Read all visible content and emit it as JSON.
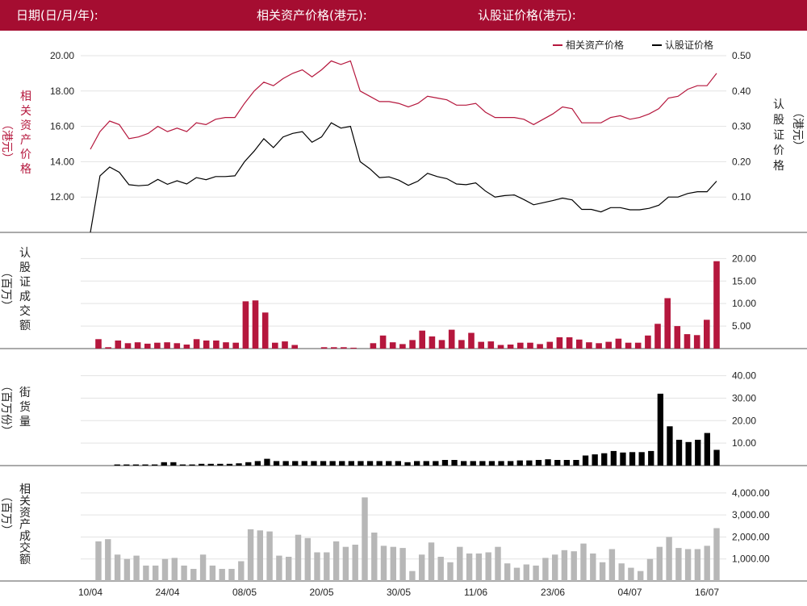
{
  "header": {
    "date_label": "日期(日/月/年):",
    "underlying_label": "相关资产价格(港元):",
    "warrant_label": "认股证价格(港元):"
  },
  "colors": {
    "brand": "#a50d31",
    "underlying": "#b5173d",
    "warrant": "#000000",
    "bar_red": "#b5173d",
    "bar_black": "#000000",
    "bar_gray": "#b7b7b7"
  },
  "chart_data": [
    {
      "type": "line",
      "panel": "price",
      "legend": [
        "相关资产价格",
        "认股证价格"
      ],
      "left_axis": {
        "label": [
          "相",
          "关",
          "资",
          "产",
          "价",
          "格"
        ],
        "unit": "（港元）",
        "ticks": [
          "12.00",
          "14.00",
          "16.00",
          "18.00",
          "20.00"
        ],
        "ylim": [
          10.0,
          20.5
        ]
      },
      "right_axis": {
        "label": [
          "认",
          "股",
          "证",
          "价",
          "格"
        ],
        "unit": "（港元）",
        "ticks": [
          "0.10",
          "0.20",
          "0.30",
          "0.40",
          "0.50"
        ],
        "ylim": [
          0.0,
          0.525
        ]
      },
      "x_ticks": [
        {
          "label": "10/04",
          "index": 0
        },
        {
          "label": "24/04",
          "index": 8
        },
        {
          "label": "08/05",
          "index": 16
        },
        {
          "label": "20/05",
          "index": 24
        },
        {
          "label": "30/05",
          "index": 32
        },
        {
          "label": "11/06",
          "index": 40
        },
        {
          "label": "23/06",
          "index": 48
        },
        {
          "label": "04/07",
          "index": 56
        },
        {
          "label": "16/07",
          "index": 64
        }
      ],
      "series": [
        {
          "name": "相关资产价格",
          "axis": "left",
          "values": [
            14.7,
            15.7,
            16.3,
            16.1,
            15.3,
            15.4,
            15.6,
            16.0,
            15.7,
            15.9,
            15.7,
            16.2,
            16.1,
            16.4,
            16.5,
            16.5,
            17.3,
            18.0,
            18.5,
            18.3,
            18.7,
            19.0,
            19.2,
            18.8,
            19.2,
            19.7,
            19.5,
            19.7,
            18.0,
            17.7,
            17.4,
            17.4,
            17.3,
            17.1,
            17.3,
            17.7,
            17.6,
            17.5,
            17.2,
            17.2,
            17.3,
            16.8,
            16.5,
            16.5,
            16.5,
            16.4,
            16.1,
            16.4,
            16.7,
            17.1,
            17.0,
            16.2,
            16.2,
            16.2,
            16.5,
            16.6,
            16.4,
            16.5,
            16.7,
            17.0,
            17.6,
            17.7,
            18.1,
            18.3,
            18.3,
            19.0
          ]
        },
        {
          "name": "认股证价格",
          "axis": "right",
          "values": [
            0.0,
            0.16,
            0.185,
            0.17,
            0.135,
            0.132,
            0.134,
            0.15,
            0.136,
            0.146,
            0.137,
            0.155,
            0.149,
            0.158,
            0.158,
            0.16,
            0.2,
            0.23,
            0.265,
            0.24,
            0.27,
            0.28,
            0.285,
            0.255,
            0.27,
            0.31,
            0.295,
            0.3,
            0.2,
            0.18,
            0.155,
            0.157,
            0.148,
            0.133,
            0.145,
            0.167,
            0.158,
            0.152,
            0.137,
            0.135,
            0.14,
            0.117,
            0.1,
            0.104,
            0.106,
            0.093,
            0.078,
            0.084,
            0.09,
            0.097,
            0.092,
            0.065,
            0.065,
            0.058,
            0.07,
            0.07,
            0.064,
            0.064,
            0.068,
            0.077,
            0.1,
            0.1,
            0.11,
            0.115,
            0.115,
            0.145
          ]
        }
      ]
    },
    {
      "type": "bar",
      "panel": "warrant_turnover",
      "axis_label": [
        "认",
        "股",
        "证",
        "成",
        "交",
        "额"
      ],
      "unit": "（百万）",
      "ticks": [
        "5.00",
        "10.00",
        "15.00",
        "20.00"
      ],
      "ylim": [
        0,
        21.5
      ],
      "values": [
        2.1,
        0.3,
        1.8,
        1.2,
        1.4,
        1.1,
        1.3,
        1.4,
        1.2,
        0.9,
        2.1,
        1.8,
        1.8,
        1.4,
        1.3,
        10.5,
        10.7,
        8.0,
        1.3,
        1.6,
        0.8,
        0,
        0,
        0.3,
        0.3,
        0.3,
        0.2,
        0,
        1.2,
        2.9,
        1.4,
        1.0,
        1.9,
        4.0,
        2.7,
        1.9,
        4.2,
        1.9,
        3.5,
        1.5,
        1.6,
        0.8,
        0.9,
        1.3,
        1.3,
        1.0,
        1.5,
        2.5,
        2.5,
        2.0,
        1.4,
        1.2,
        1.5,
        2.2,
        1.3,
        1.3,
        2.9,
        5.5,
        11.2,
        5.0,
        3.2,
        3.0,
        6.4,
        19.4
      ]
    },
    {
      "type": "bar",
      "panel": "outstanding",
      "axis_label": [
        "街",
        "货",
        "量"
      ],
      "unit": "（百万份）",
      "ticks": [
        "10.00",
        "20.00",
        "30.00",
        "40.00"
      ],
      "ylim": [
        0,
        42
      ],
      "values": [
        0,
        0,
        0.5,
        0.5,
        0.5,
        0.5,
        0.5,
        1.5,
        1.5,
        0.5,
        0.5,
        0.8,
        0.8,
        0.8,
        0.8,
        1.0,
        1.5,
        2.0,
        3.0,
        2.0,
        2.0,
        2.0,
        2.0,
        2.0,
        2.0,
        2.0,
        2.0,
        2.0,
        2.0,
        2.0,
        2.0,
        2.0,
        2.0,
        1.5,
        2.0,
        2.0,
        2.0,
        2.5,
        2.5,
        2.0,
        2.0,
        2.0,
        2.0,
        2.0,
        2.0,
        2.3,
        2.3,
        2.5,
        2.8,
        2.5,
        2.5,
        2.5,
        4.5,
        5.0,
        5.5,
        6.5,
        5.8,
        6.0,
        6.0,
        6.5,
        32.0,
        17.5,
        11.5,
        10.5,
        11.5,
        14.5,
        7.0
      ]
    },
    {
      "type": "bar",
      "panel": "underlying_turnover",
      "axis_label": [
        "相",
        "关",
        "资",
        "产",
        "成",
        "交",
        "额"
      ],
      "unit": "（百万）",
      "ticks": [
        "1,000.00",
        "2,000.00",
        "3,000.00",
        "4,000.00"
      ],
      "ylim": [
        0,
        4400
      ],
      "values": [
        1800,
        1900,
        1200,
        1000,
        1150,
        700,
        700,
        1000,
        1050,
        700,
        550,
        1200,
        700,
        550,
        550,
        900,
        2350,
        2300,
        2250,
        1150,
        1100,
        2100,
        1950,
        1300,
        1300,
        1800,
        1550,
        1650,
        3800,
        2200,
        1600,
        1550,
        1500,
        450,
        1200,
        1750,
        1100,
        850,
        1550,
        1250,
        1250,
        1300,
        1550,
        800,
        600,
        750,
        700,
        1050,
        1200,
        1400,
        1350,
        1700,
        1250,
        850,
        1450,
        800,
        600,
        450,
        1000,
        1550,
        2000,
        1500,
        1450,
        1450,
        1600,
        2400
      ]
    }
  ]
}
